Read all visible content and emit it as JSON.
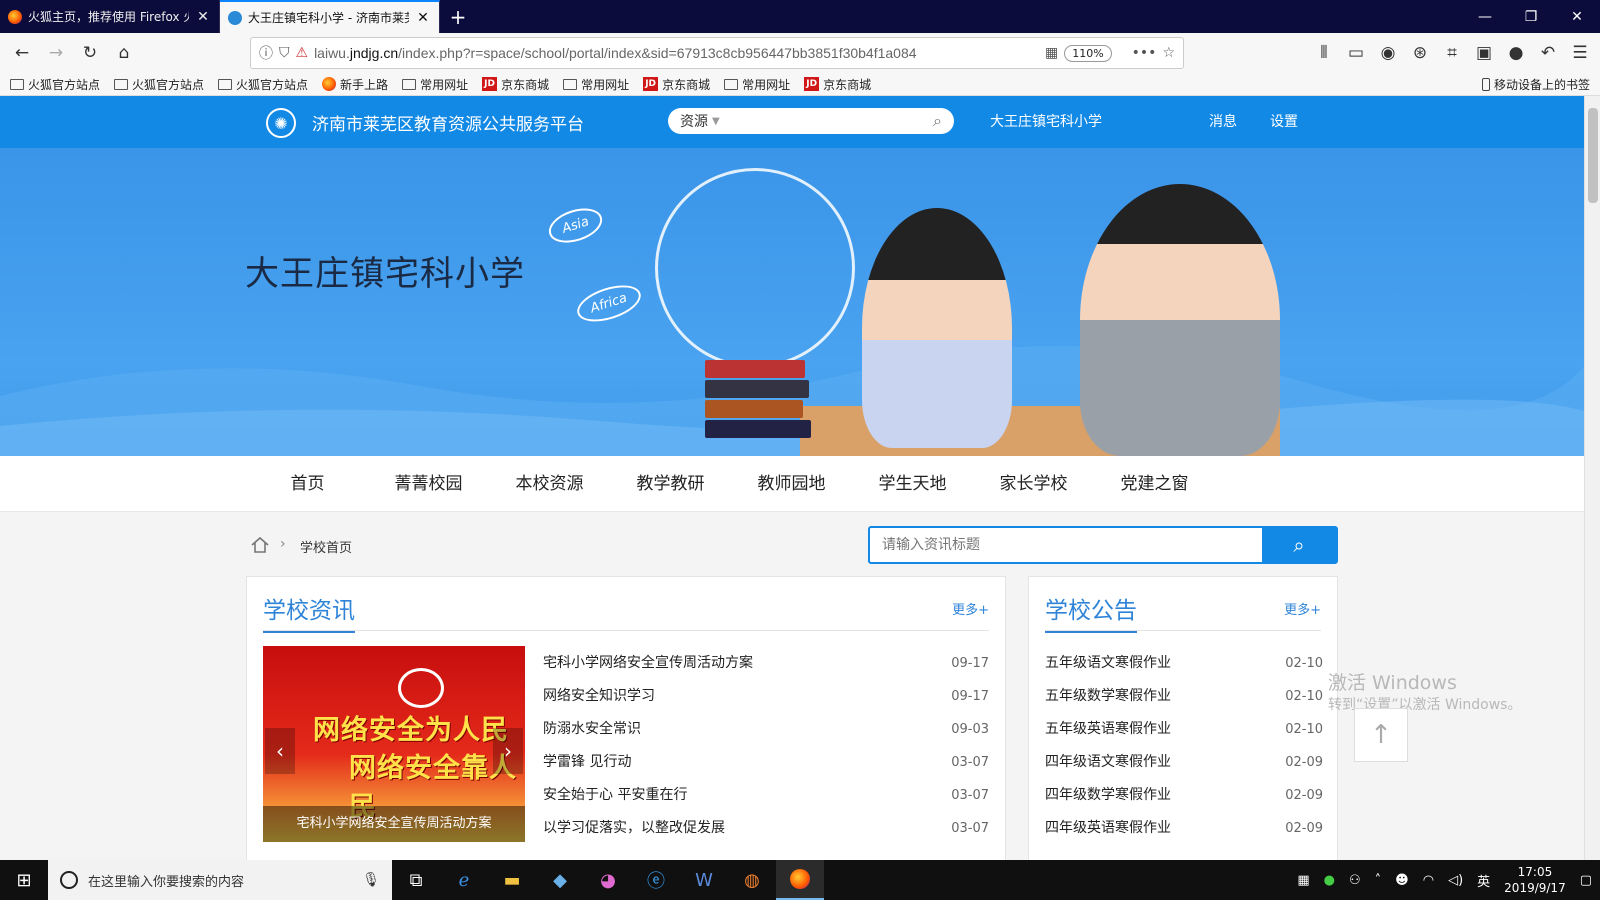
{
  "browser": {
    "tabs": [
      {
        "title": "火狐主页，推荐使用 Firefox 火",
        "active": false
      },
      {
        "title": "大王庄镇宅科小学 - 济南市莱芜",
        "active": true
      }
    ],
    "new_tab": "+",
    "url_prefix": "laiwu.",
    "url_domain": "jndjg.cn",
    "url_path": "/index.php?r=space/school/portal/index&sid=67913c8cb956447bb3851f30b4f1a084",
    "zoom": "110%",
    "bookmarks": [
      {
        "label": "火狐官方站点",
        "icon": "folder-icon"
      },
      {
        "label": "火狐官方站点",
        "icon": "folder-icon"
      },
      {
        "label": "火狐官方站点",
        "icon": "folder-icon"
      },
      {
        "label": "新手上路",
        "icon": "firefox-icon"
      },
      {
        "label": "常用网址",
        "icon": "folder-icon"
      },
      {
        "label": "京东商城",
        "icon": "jd-icon"
      },
      {
        "label": "常用网址",
        "icon": "folder-icon"
      },
      {
        "label": "京东商城",
        "icon": "jd-icon"
      },
      {
        "label": "常用网址",
        "icon": "folder-icon"
      },
      {
        "label": "京东商城",
        "icon": "jd-icon"
      }
    ],
    "mobile_bookmarks": "移动设备上的书签"
  },
  "site": {
    "platform_name": "济南市莱芜区教育资源公共服务平台",
    "search_category": "资源",
    "school_link": "大王庄镇宅科小学",
    "messages": "消息",
    "settings": "设置",
    "brand_color": "#1389e6"
  },
  "banner": {
    "title": "大王庄镇宅科小学",
    "tag_asia": "Asia",
    "tag_africa": "Africa"
  },
  "mainnav": [
    "首页",
    "菁菁校园",
    "本校资源",
    "教学教研",
    "教师园地",
    "学生天地",
    "家长学校",
    "党建之窗"
  ],
  "breadcrumb": {
    "current": "学校首页"
  },
  "news_search": {
    "placeholder": "请输入资讯标题"
  },
  "news": {
    "title": "学校资讯",
    "more": "更多+",
    "carousel": {
      "line1": "网络安全为人民",
      "line2": "网络安全靠人民",
      "caption": "宅科小学网络安全宣传周活动方案"
    },
    "items": [
      {
        "title": "宅科小学网络安全宣传周活动方案",
        "date": "09-17"
      },
      {
        "title": "网络安全知识学习",
        "date": "09-17"
      },
      {
        "title": "防溺水安全常识",
        "date": "09-03"
      },
      {
        "title": "学雷锋 见行动",
        "date": "03-07"
      },
      {
        "title": "安全始于心 平安重在行",
        "date": "03-07"
      },
      {
        "title": "以学习促落实，以整改促发展",
        "date": "03-07"
      }
    ]
  },
  "notices": {
    "title": "学校公告",
    "more": "更多+",
    "items": [
      {
        "title": "五年级语文寒假作业",
        "date": "02-10"
      },
      {
        "title": "五年级数学寒假作业",
        "date": "02-10"
      },
      {
        "title": "五年级英语寒假作业",
        "date": "02-10"
      },
      {
        "title": "四年级语文寒假作业",
        "date": "02-09"
      },
      {
        "title": "四年级数学寒假作业",
        "date": "02-09"
      },
      {
        "title": "四年级英语寒假作业",
        "date": "02-09"
      }
    ]
  },
  "watermark": {
    "line1": "激活 Windows",
    "line2": "转到“设置”以激活 Windows。"
  },
  "taskbar": {
    "search_placeholder": "在这里输入你要搜索的内容",
    "ime": "英",
    "time": "17:05",
    "date": "2019/9/17"
  }
}
